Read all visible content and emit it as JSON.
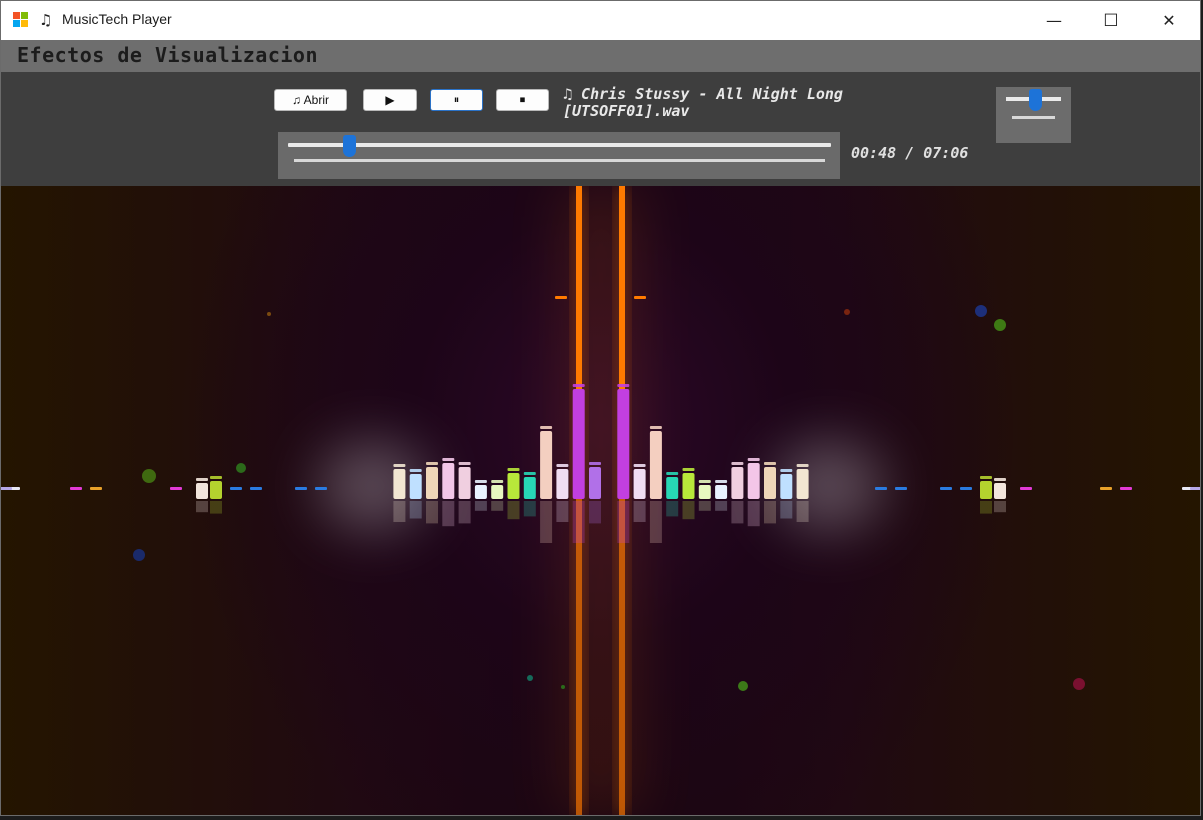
{
  "window": {
    "title": "MusicTech Player",
    "minimize_glyph": "—",
    "maximize_glyph": "☐",
    "close_glyph": "✕"
  },
  "header": {
    "title": "Efectos de Visualizacion"
  },
  "controls": {
    "open_label": "♫ Abrir",
    "play_glyph": "▶",
    "pause_glyph": "⏸",
    "stop_glyph": "⏹",
    "track_title": "♫ Chris Stussy - All Night Long [UTSOFF01].wav",
    "time_display": "00:48 / 07:06",
    "seek_fraction": 0.113,
    "volume_fraction": 0.52
  },
  "colors": {
    "accent": "#1d73d8",
    "background": "#3e3e3e",
    "header": "#6e6e6e",
    "beam": "#ff7a00"
  },
  "visualizer": {
    "bars": [
      {
        "h": 30,
        "c": "#f2e6d2"
      },
      {
        "h": 25,
        "c": "#bfe0ff"
      },
      {
        "h": 32,
        "c": "#efd6b8"
      },
      {
        "h": 36,
        "c": "#f3c6e8"
      },
      {
        "h": 32,
        "c": "#f0cfe0"
      },
      {
        "h": 14,
        "c": "#e9f2ff"
      },
      {
        "h": 14,
        "c": "#e8f8c0"
      },
      {
        "h": 26,
        "c": "#b8e83a"
      },
      {
        "h": 22,
        "c": "#27d7b5"
      },
      {
        "h": 68,
        "c": "#f4cfc0"
      },
      {
        "h": 30,
        "c": "#f0ddf2"
      },
      {
        "h": 110,
        "c": "#c23fe0"
      }
    ],
    "center_bar": {
      "h": 32,
      "c": "#b170e8"
    },
    "far_bars": [
      {
        "h": 18,
        "c": "#b4d22e"
      },
      {
        "h": 16,
        "c": "#f3e5dc"
      }
    ]
  }
}
